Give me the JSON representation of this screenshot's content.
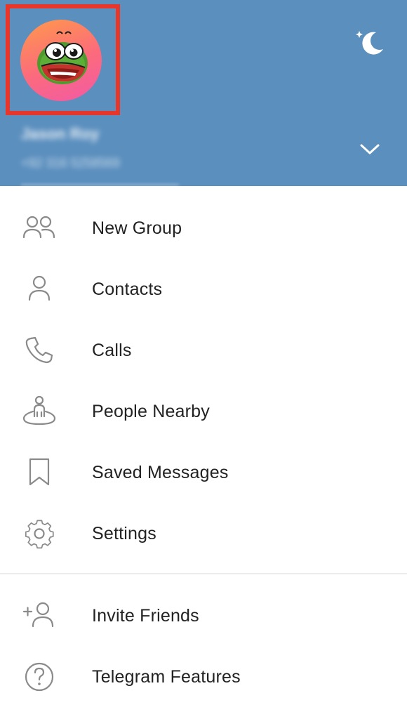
{
  "header": {
    "user_name": "Jason Roy",
    "user_phone": "+92 316 5258569",
    "background_color": "#5b8fbe",
    "highlight_color": "#e8362a",
    "avatar_icon": "frog-sticker-avatar",
    "night_mode_icon": "moon-stars-icon",
    "expand_icon": "chevron-down-icon"
  },
  "menu": {
    "items": [
      {
        "label": "New Group",
        "icon": "group-icon"
      },
      {
        "label": "Contacts",
        "icon": "person-icon"
      },
      {
        "label": "Calls",
        "icon": "phone-icon"
      },
      {
        "label": "People Nearby",
        "icon": "people-nearby-icon"
      },
      {
        "label": "Saved Messages",
        "icon": "bookmark-icon"
      },
      {
        "label": "Settings",
        "icon": "gear-icon"
      }
    ],
    "secondary_items": [
      {
        "label": "Invite Friends",
        "icon": "add-person-icon"
      },
      {
        "label": "Telegram Features",
        "icon": "question-circle-icon"
      }
    ]
  }
}
